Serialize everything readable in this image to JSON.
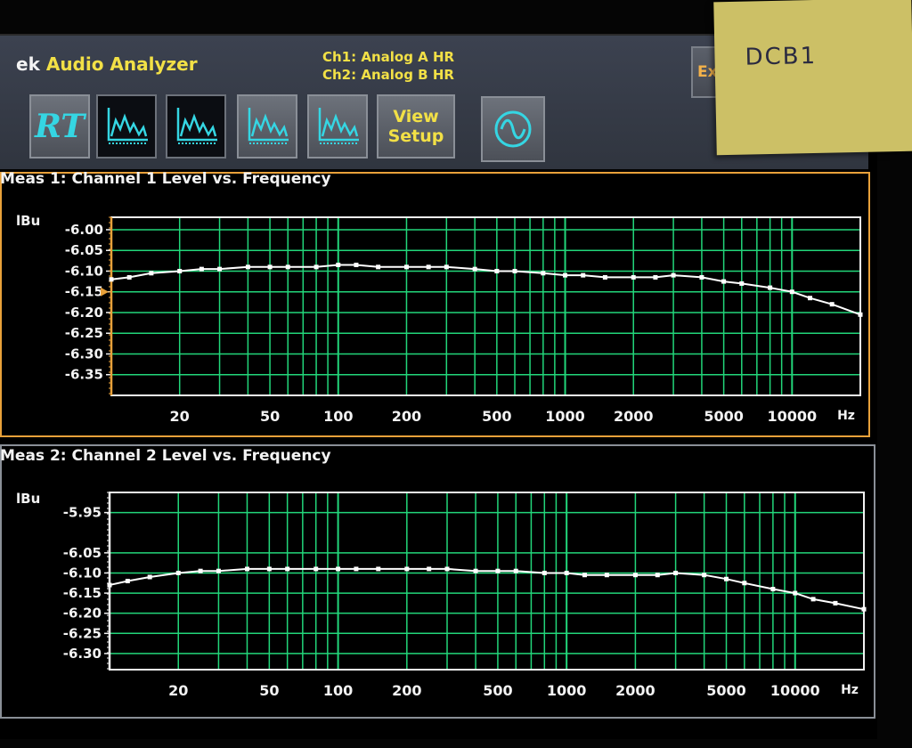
{
  "app": {
    "title_prefix": "ek",
    "title_main": "Audio Analyzer",
    "ch1_label": "Ch1: Analog A HR",
    "ch2_label": "Ch2: Analog B HR",
    "export_label": "Exp"
  },
  "toolbar": {
    "rt_label": "RT",
    "view_setup_line1": "View",
    "view_setup_line2": "Setup"
  },
  "sticky_note": {
    "text": "DCB1"
  },
  "colors": {
    "grid": "#22d67a",
    "trace": "#ffffff",
    "accent": "#f2e046",
    "active_border": "#e8a13a"
  },
  "chart_data": [
    {
      "type": "line",
      "title": "Meas 1: Channel 1 Level vs. Frequency",
      "ylabel": "lBu",
      "xunit": "Hz",
      "xscale": "log",
      "xlim": [
        10,
        20000
      ],
      "ylim": [
        -6.4,
        -5.97
      ],
      "yticks": [
        "-6.00",
        "-6.05",
        "-6.10",
        "-6.15",
        "-6.20",
        "-6.25",
        "-6.30",
        "-6.35"
      ],
      "xticks": [
        "20",
        "50",
        "100",
        "200",
        "500",
        "1000",
        "2000",
        "5000",
        "10000"
      ],
      "series": [
        {
          "x": [
            10,
            12,
            15,
            20,
            25,
            30,
            40,
            50,
            60,
            80,
            100,
            120,
            150,
            200,
            250,
            300,
            400,
            500,
            600,
            800,
            1000,
            1200,
            1500,
            2000,
            2500,
            3000,
            4000,
            5000,
            6000,
            8000,
            10000,
            12000,
            15000,
            20000
          ],
          "y": [
            -6.12,
            -6.115,
            -6.105,
            -6.1,
            -6.095,
            -6.095,
            -6.09,
            -6.09,
            -6.09,
            -6.09,
            -6.085,
            -6.085,
            -6.09,
            -6.09,
            -6.09,
            -6.09,
            -6.095,
            -6.1,
            -6.1,
            -6.105,
            -6.11,
            -6.11,
            -6.115,
            -6.115,
            -6.115,
            -6.11,
            -6.115,
            -6.125,
            -6.13,
            -6.14,
            -6.15,
            -6.165,
            -6.18,
            -6.205
          ]
        }
      ]
    },
    {
      "type": "line",
      "title": "Meas 2: Channel 2 Level vs. Frequency",
      "ylabel": "lBu",
      "xunit": "Hz",
      "xscale": "log",
      "xlim": [
        10,
        20000
      ],
      "ylim": [
        -6.34,
        -5.9
      ],
      "yticks": [
        "-5.95",
        "-6.05",
        "-6.10",
        "-6.15",
        "-6.20",
        "-6.25",
        "-6.30"
      ],
      "xticks": [
        "20",
        "50",
        "100",
        "200",
        "500",
        "1000",
        "2000",
        "5000",
        "10000"
      ],
      "series": [
        {
          "x": [
            10,
            12,
            15,
            20,
            25,
            30,
            40,
            50,
            60,
            80,
            100,
            120,
            150,
            200,
            250,
            300,
            400,
            500,
            600,
            800,
            1000,
            1200,
            1500,
            2000,
            2500,
            3000,
            4000,
            5000,
            6000,
            8000,
            10000,
            12000,
            15000,
            20000
          ],
          "y": [
            -6.13,
            -6.12,
            -6.11,
            -6.1,
            -6.095,
            -6.095,
            -6.09,
            -6.09,
            -6.09,
            -6.09,
            -6.09,
            -6.09,
            -6.09,
            -6.09,
            -6.09,
            -6.09,
            -6.095,
            -6.095,
            -6.095,
            -6.1,
            -6.1,
            -6.105,
            -6.105,
            -6.105,
            -6.105,
            -6.1,
            -6.105,
            -6.115,
            -6.125,
            -6.14,
            -6.15,
            -6.165,
            -6.175,
            -6.19
          ]
        }
      ]
    }
  ]
}
